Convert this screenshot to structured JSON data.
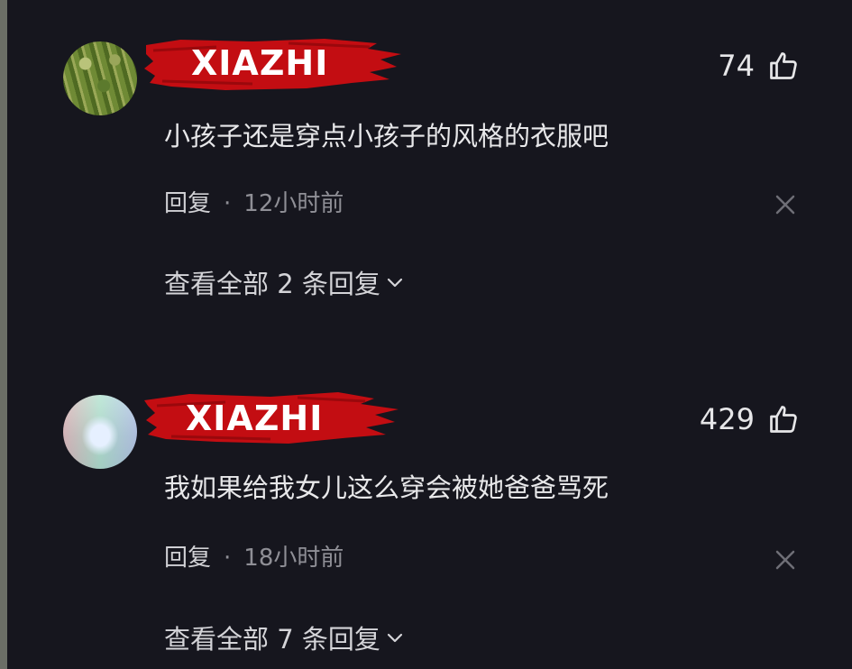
{
  "comments": [
    {
      "username": "XIAZHI",
      "text": "小孩子还是穿点小孩子的风格的衣服吧",
      "likes": "74",
      "reply_label": "回复",
      "time": "12小时前",
      "view_replies": "查看全部 2 条回复"
    },
    {
      "username": "XIAZHI",
      "text": "我如果给我女儿这么穿会被她爸爸骂死",
      "likes": "429",
      "reply_label": "回复",
      "time": "18小时前",
      "view_replies": "查看全部 7 条回复"
    }
  ],
  "separator": "·",
  "icons": {
    "like": "thumbs-up-icon",
    "close": "close-icon",
    "expand": "chevron-down-icon"
  },
  "colors": {
    "background": "#16161e",
    "name_brush": "#c30d12",
    "text": "#e8e8ea",
    "muted": "#8f8f96"
  }
}
